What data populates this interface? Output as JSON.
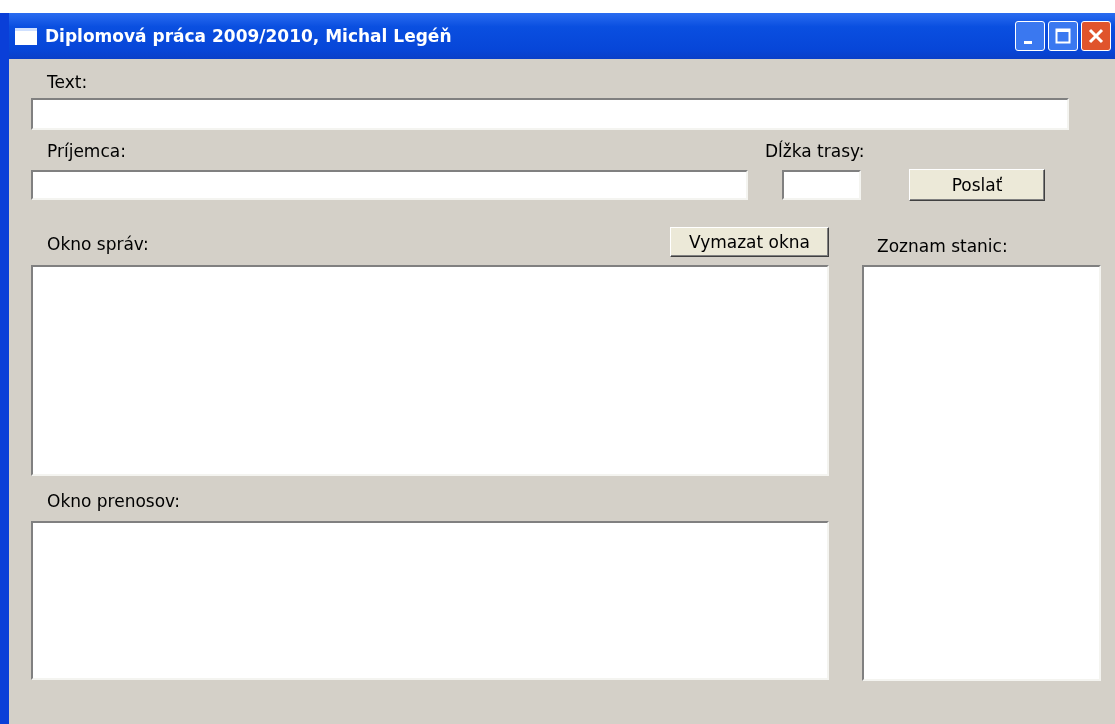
{
  "window": {
    "title": "Diplomová práca 2009/2010, Michal Legéň"
  },
  "text_field": {
    "label": "Text:"
  },
  "recipient_field": {
    "label": "Príjemca:"
  },
  "route_length_field": {
    "label": "Dĺžka trasy:"
  },
  "send_button": {
    "label": "Poslať"
  },
  "messages_pane": {
    "label": "Okno správ:"
  },
  "clear_button": {
    "label": "Vymazat okna"
  },
  "transfers_pane": {
    "label": "Okno prenosov:"
  },
  "stations_list": {
    "label": "Zoznam stanic:"
  }
}
